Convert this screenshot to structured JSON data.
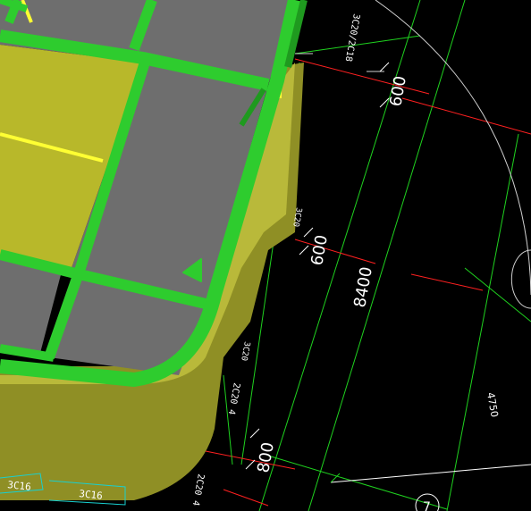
{
  "colors": {
    "background": "#000000",
    "slab": "#6e6e6e",
    "beam_green": "#2ecc2e",
    "beam_dark_green": "#1f9a1f",
    "olive_wall": "#9a9a2a",
    "olive_highlight": "#c8c83c",
    "yellow_line": "#ffff33",
    "dim_line_green": "#1fd21f",
    "axis_red": "#ff2020",
    "text_white": "#ffffff",
    "label_cyan": "#19d0d0"
  },
  "dimensions": {
    "d1": "600",
    "d2": "600",
    "span": "8400",
    "d3": "800",
    "radius": "4750"
  },
  "labels": {
    "rebar_top": "3C20/2C18",
    "rebar_mid1": "3C20",
    "rebar_mid2": "3C20",
    "rebar_left": "2C20 4",
    "rebar_bottom": "2C20 4",
    "tag1": "3C16",
    "tag2": "3C16",
    "axis": "7"
  }
}
